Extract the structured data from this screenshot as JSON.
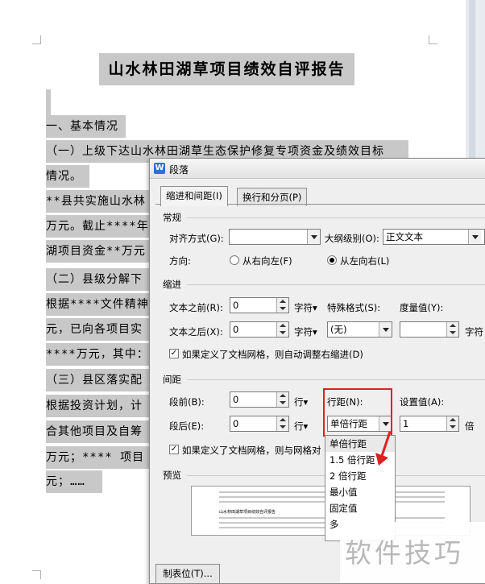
{
  "document": {
    "title": "山水林田湖草项目绩效自评报告",
    "lines": [
      "一、基本情况",
      "（一）上级下达山水林田湖草生态保护修复专项资金及绩效目标",
      "情况。",
      "**县共实施山水林",
      "万元。截止****年",
      "湖项目资金**万元",
      "（二）县级分解下",
      "根据****文件精神",
      "元，已向各项目实",
      "****万元，其中：",
      "（三）县区落实配",
      "根据投资计划，计",
      "合其他项目及自筹",
      "万元；**** 项目",
      "元；……"
    ]
  },
  "dialog": {
    "icon_letter": "W",
    "title": "段落",
    "tabs": [
      "缩进和间距(I)",
      "换行和分页(P)"
    ],
    "general": {
      "heading": "常规",
      "align_label": "对齐方式(G):",
      "align_value": "",
      "outline_label": "大纲级别(O):",
      "outline_value": "正文文本",
      "direction_label": "方向:",
      "rtl_label": "从右向左(F)",
      "ltr_label": "从左向右(L)"
    },
    "indent": {
      "heading": "缩进",
      "before_label": "文本之前(R):",
      "before_value": "0",
      "before_unit": "字符▾",
      "after_label": "文本之后(X):",
      "after_value": "0",
      "after_unit": "字符▾",
      "special_label": "特殊格式(S):",
      "special_value": "(无)",
      "measure_label": "度量值(Y):",
      "measure_value": "",
      "measure_unit": "字符",
      "grid_check_label": "如果定义了文档网格，则自动调整右缩进(D)"
    },
    "spacing": {
      "heading": "间距",
      "before_label": "段前(B):",
      "before_value": "0",
      "before_unit": "行▾",
      "after_label": "段后(E):",
      "after_value": "0",
      "after_unit": "行▾",
      "line_label": "行距(N):",
      "line_value": "单倍行距",
      "setting_label": "设置值(A):",
      "setting_value": "1",
      "setting_unit": "倍",
      "grid_check_label": "如果定义了文档网格，则与网格对"
    },
    "line_spacing_options": [
      "单倍行距",
      "1.5 倍行距",
      "2 倍行距",
      "最小值",
      "固定值",
      "多"
    ],
    "preview": {
      "heading": "预览",
      "sample_title": "山水林田湖草项目绩效自评报告"
    },
    "tabstops_button": "制表位(T)..."
  },
  "watermark": "软件技巧",
  "colors": {
    "highlight": "#c8c8c8",
    "annotation_red": "#e02020",
    "dialog_bg": "#efefef"
  }
}
